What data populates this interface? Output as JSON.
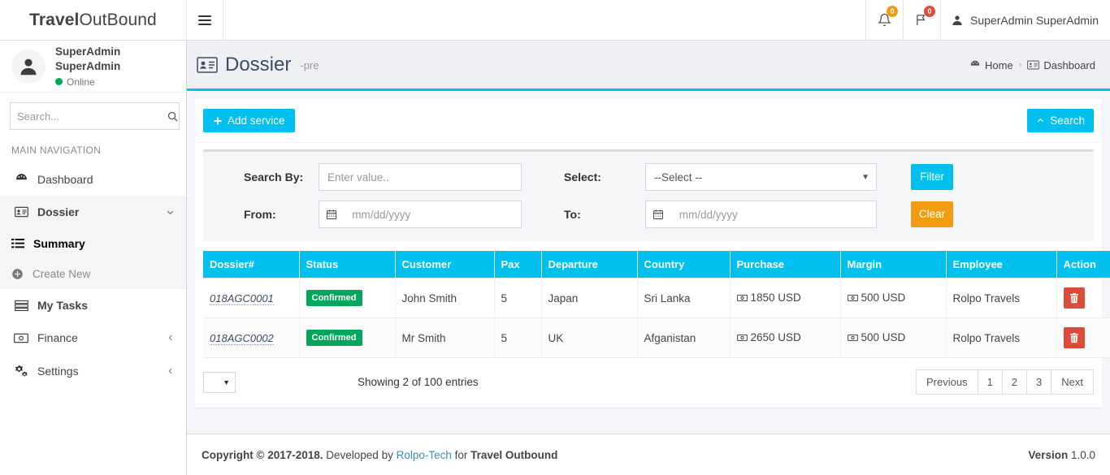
{
  "brand": {
    "bold": "Travel",
    "rest": "OutBound"
  },
  "navbar": {
    "toggle_label": "toggle-menu",
    "notifications_badge": "0",
    "flags_badge": "0",
    "user_name": "SuperAdmin SuperAdmin"
  },
  "sidebar": {
    "user": {
      "name": "SuperAdmin SuperAdmin",
      "status": "Online"
    },
    "search_placeholder": "Search...",
    "nav_header": "MAIN NAVIGATION",
    "items": [
      {
        "label": "Dashboard",
        "icon": "dashboard-icon",
        "has_arrow": false
      },
      {
        "label": "Dossier",
        "icon": "id-card-icon",
        "has_arrow": true,
        "arrow": "chevron-down"
      },
      {
        "label": "My Tasks",
        "icon": "tasks-icon",
        "has_arrow": false
      },
      {
        "label": "Finance",
        "icon": "money-icon",
        "has_arrow": true,
        "arrow": "chevron-left"
      },
      {
        "label": "Settings",
        "icon": "gears-icon",
        "has_arrow": true,
        "arrow": "chevron-left"
      }
    ],
    "dossier_children": [
      {
        "label": "Summary",
        "icon": "list-icon",
        "active": true
      },
      {
        "label": "Create New",
        "icon": "plus-circle-icon",
        "active": false
      }
    ]
  },
  "content_header": {
    "title": "Dossier",
    "subtitle": "-pre",
    "breadcrumb": [
      {
        "label": "Home",
        "icon": "dashboard-icon"
      },
      {
        "label": "Dashboard",
        "icon": "id-card-icon"
      }
    ],
    "separator": "›"
  },
  "toolbar": {
    "add_service_label": "Add service",
    "search_toggle_label": "Search"
  },
  "filters": {
    "search_by_label": "Search By:",
    "search_by_placeholder": "Enter value..",
    "select_label": "Select:",
    "select_value": "--Select --",
    "from_label": "From:",
    "from_placeholder": "mm/dd/yyyy",
    "to_label": "To:",
    "to_placeholder": "mm/dd/yyyy",
    "filter_button": "Filter",
    "clear_button": "Clear"
  },
  "table": {
    "columns": [
      "Dossier#",
      "Status",
      "Customer",
      "Pax",
      "Departure",
      "Country",
      "Purchase",
      "Margin",
      "Employee",
      "Action"
    ],
    "rows": [
      {
        "dossier": "018AGC0001",
        "status": "Confirmed",
        "customer": "John Smith",
        "pax": "5",
        "departure": "Japan",
        "country": "Sri Lanka",
        "purchase": "1850 USD",
        "margin": "500 USD",
        "employee": "Rolpo Travels",
        "action": "delete-button"
      },
      {
        "dossier": "018AGC0002",
        "status": "Confirmed",
        "customer": "Mr Smith",
        "pax": "5",
        "departure": "UK",
        "country": "Afganistan",
        "purchase": "2650 USD",
        "margin": "500 USD",
        "employee": "Rolpo Travels",
        "action": "delete-button"
      }
    ]
  },
  "table_footer": {
    "length_value": "",
    "showing_info": "Showing 2 of 100 entries",
    "pagination": {
      "previous": "Previous",
      "pages": [
        "1",
        "2",
        "3"
      ],
      "next": "Next"
    }
  },
  "footer": {
    "copyright_bold": "Copyright © 2017-2018.",
    "developed_by": " Developed by ",
    "company_link": "Rolpo-Tech",
    "for_text": " for ",
    "product": "Travel Outbound",
    "version_label": "Version",
    "version_number": "1.0.0"
  },
  "colors": {
    "accent": "#00c0ef",
    "success": "#00a65a",
    "warning": "#f39c12",
    "danger": "#dd4b39",
    "link": "#3c8dbc"
  }
}
